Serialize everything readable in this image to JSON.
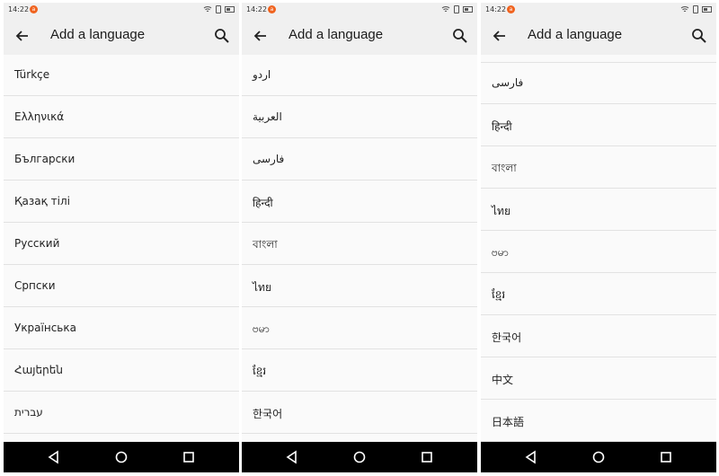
{
  "screens": [
    {
      "status": {
        "time": "14:22",
        "notif": "a"
      },
      "title": "Add a language",
      "items": [
        "Türkçe",
        "Ελληνικά",
        "Български",
        "Қазақ тілі",
        "Русский",
        "Српски",
        "Українська",
        "Հայերեն",
        "עברית"
      ]
    },
    {
      "status": {
        "time": "14:22",
        "notif": "a"
      },
      "title": "Add a language",
      "items": [
        "اردو",
        "العربية",
        "فارسی",
        "हिन्दी",
        "বাংলা",
        "ไทย",
        "ဗမာ",
        "ខ្មែរ",
        "한국어"
      ]
    },
    {
      "status": {
        "time": "14:22",
        "notif": "a"
      },
      "title": "Add a language",
      "items": [
        "فارسی",
        "हिन्दी",
        "বাংলা",
        "ไทย",
        "ဗမာ",
        "ខ្មែរ",
        "한국어",
        "中文",
        "日本語"
      ]
    }
  ],
  "icons": {
    "back": "arrow-back-icon",
    "search": "search-icon",
    "nav_back": "triangle-back-icon",
    "nav_home": "circle-home-icon",
    "nav_recent": "square-recent-icon",
    "wifi": "wifi-icon",
    "sim": "sim-icon",
    "battery": "battery-icon"
  },
  "colors": {
    "notification": "#f0631f",
    "appbar": "#f0f0f0",
    "list_bg": "#fafafa",
    "divider": "#e2e2e2",
    "navbar": "#000000"
  }
}
